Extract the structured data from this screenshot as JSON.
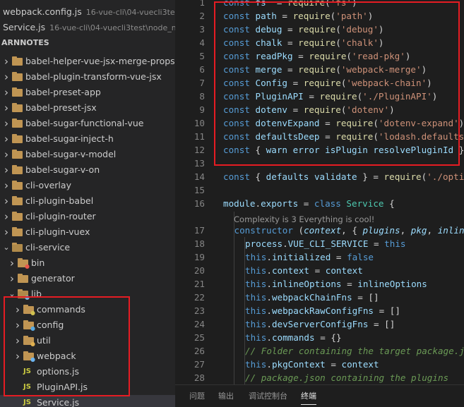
{
  "open_editors": [
    {
      "name": "webpack.config.js",
      "desc": "16-vue-cli\\04-vuecli3test..."
    },
    {
      "name": "Service.js",
      "desc": "16-vue-cli\\04-vuecli3test\\node_m..."
    }
  ],
  "section_title": "ARNNOTES",
  "tree": [
    {
      "label": "babel-helper-vue-jsx-merge-props",
      "depth": 0,
      "kind": "folder",
      "open": false
    },
    {
      "label": "babel-plugin-transform-vue-jsx",
      "depth": 0,
      "kind": "folder",
      "open": false
    },
    {
      "label": "babel-preset-app",
      "depth": 0,
      "kind": "folder",
      "open": false
    },
    {
      "label": "babel-preset-jsx",
      "depth": 0,
      "kind": "folder",
      "open": false
    },
    {
      "label": "babel-sugar-functional-vue",
      "depth": 0,
      "kind": "folder",
      "open": false
    },
    {
      "label": "babel-sugar-inject-h",
      "depth": 0,
      "kind": "folder",
      "open": false
    },
    {
      "label": "babel-sugar-v-model",
      "depth": 0,
      "kind": "folder",
      "open": false
    },
    {
      "label": "babel-sugar-v-on",
      "depth": 0,
      "kind": "folder",
      "open": false
    },
    {
      "label": "cli-overlay",
      "depth": 0,
      "kind": "folder",
      "open": false
    },
    {
      "label": "cli-plugin-babel",
      "depth": 0,
      "kind": "folder",
      "open": false
    },
    {
      "label": "cli-plugin-router",
      "depth": 0,
      "kind": "folder",
      "open": false
    },
    {
      "label": "cli-plugin-vuex",
      "depth": 0,
      "kind": "folder",
      "open": false
    },
    {
      "label": "cli-service",
      "depth": 0,
      "kind": "folder",
      "open": true
    },
    {
      "label": "bin",
      "depth": 1,
      "kind": "folder",
      "open": false,
      "badge": "bin"
    },
    {
      "label": "generator",
      "depth": 1,
      "kind": "folder",
      "open": false
    },
    {
      "label": "lib",
      "depth": 1,
      "kind": "folder",
      "open": true,
      "badge": "lib"
    },
    {
      "label": "commands",
      "depth": 2,
      "kind": "folder",
      "open": false,
      "badge": "cmd"
    },
    {
      "label": "config",
      "depth": 2,
      "kind": "folder",
      "open": false,
      "badge": "cfg"
    },
    {
      "label": "util",
      "depth": 2,
      "kind": "folder",
      "open": false,
      "badge": "util"
    },
    {
      "label": "webpack",
      "depth": 2,
      "kind": "folder",
      "open": false,
      "badge": "wp"
    },
    {
      "label": "options.js",
      "depth": 2,
      "kind": "js"
    },
    {
      "label": "PluginAPI.js",
      "depth": 2,
      "kind": "js"
    },
    {
      "label": "Service.js",
      "depth": 2,
      "kind": "js",
      "selected": true
    }
  ],
  "code_lines": [
    {
      "n": "1",
      "indent": 0,
      "tokens": [
        [
          "kw",
          "const "
        ],
        [
          "var",
          "fs"
        ],
        [
          "",
          "  = "
        ],
        [
          "fn",
          "require"
        ],
        [
          "",
          "("
        ],
        [
          "str",
          "'fs'"
        ],
        [
          "",
          ")"
        ]
      ]
    },
    {
      "n": "2",
      "indent": 0,
      "tokens": [
        [
          "kw",
          "const "
        ],
        [
          "var",
          "path"
        ],
        [
          "",
          " = "
        ],
        [
          "fn",
          "require"
        ],
        [
          "",
          "("
        ],
        [
          "str",
          "'path'"
        ],
        [
          "",
          ")"
        ]
      ]
    },
    {
      "n": "3",
      "indent": 0,
      "tokens": [
        [
          "kw",
          "const "
        ],
        [
          "var",
          "debug"
        ],
        [
          "",
          " = "
        ],
        [
          "fn",
          "require"
        ],
        [
          "",
          "("
        ],
        [
          "str",
          "'debug'"
        ],
        [
          "",
          ")"
        ]
      ]
    },
    {
      "n": "4",
      "indent": 0,
      "tokens": [
        [
          "kw",
          "const "
        ],
        [
          "var",
          "chalk"
        ],
        [
          "",
          " = "
        ],
        [
          "fn",
          "require"
        ],
        [
          "",
          "("
        ],
        [
          "str",
          "'chalk'"
        ],
        [
          "",
          ")"
        ]
      ]
    },
    {
      "n": "5",
      "indent": 0,
      "tokens": [
        [
          "kw",
          "const "
        ],
        [
          "var",
          "readPkg"
        ],
        [
          "",
          " = "
        ],
        [
          "fn",
          "require"
        ],
        [
          "",
          "("
        ],
        [
          "str",
          "'read-pkg'"
        ],
        [
          "",
          ")"
        ]
      ]
    },
    {
      "n": "6",
      "indent": 0,
      "tokens": [
        [
          "kw",
          "const "
        ],
        [
          "var",
          "merge"
        ],
        [
          "",
          " = "
        ],
        [
          "fn",
          "require"
        ],
        [
          "",
          "("
        ],
        [
          "str",
          "'webpack-merge'"
        ],
        [
          "",
          ")"
        ]
      ]
    },
    {
      "n": "7",
      "indent": 0,
      "tokens": [
        [
          "kw",
          "const "
        ],
        [
          "var",
          "Config"
        ],
        [
          "",
          " = "
        ],
        [
          "fn",
          "require"
        ],
        [
          "",
          "("
        ],
        [
          "str",
          "'webpack-chain'"
        ],
        [
          "",
          ")"
        ]
      ]
    },
    {
      "n": "8",
      "indent": 0,
      "tokens": [
        [
          "kw",
          "const "
        ],
        [
          "var",
          "PluginAPI"
        ],
        [
          "",
          " = "
        ],
        [
          "fn",
          "require"
        ],
        [
          "",
          "("
        ],
        [
          "str",
          "'./PluginAPI'"
        ],
        [
          "",
          ")"
        ]
      ]
    },
    {
      "n": "9",
      "indent": 0,
      "tokens": [
        [
          "kw",
          "const "
        ],
        [
          "var",
          "dotenv"
        ],
        [
          "",
          " = "
        ],
        [
          "fn",
          "require"
        ],
        [
          "",
          "("
        ],
        [
          "str",
          "'dotenv'"
        ],
        [
          "",
          ")"
        ]
      ]
    },
    {
      "n": "10",
      "indent": 0,
      "tokens": [
        [
          "kw",
          "const "
        ],
        [
          "var",
          "dotenvExpand"
        ],
        [
          "",
          " = "
        ],
        [
          "fn",
          "require"
        ],
        [
          "",
          "("
        ],
        [
          "str",
          "'dotenv-expand'"
        ],
        [
          "",
          ")"
        ]
      ]
    },
    {
      "n": "11",
      "indent": 0,
      "tokens": [
        [
          "kw",
          "const "
        ],
        [
          "var",
          "defaultsDeep"
        ],
        [
          "",
          " = "
        ],
        [
          "fn",
          "require"
        ],
        [
          "",
          "("
        ],
        [
          "str",
          "'lodash.defaultsDeep'"
        ],
        [
          "",
          ")"
        ]
      ]
    },
    {
      "n": "12",
      "indent": 0,
      "tokens": [
        [
          "kw",
          "const "
        ],
        [
          "",
          "{ "
        ],
        [
          "var",
          "warn"
        ],
        [
          ", ",
          " "
        ],
        [
          "var",
          "error"
        ],
        [
          ", ",
          " "
        ],
        [
          "var",
          "isPlugin"
        ],
        [
          ", ",
          " "
        ],
        [
          "var",
          "resolvePluginId"
        ],
        [
          "",
          " }"
        ]
      ]
    },
    {
      "n": "13",
      "indent": 0,
      "tokens": []
    },
    {
      "n": "14",
      "indent": 0,
      "tokens": [
        [
          "kw",
          "const "
        ],
        [
          "",
          "{ "
        ],
        [
          "var",
          "defaults"
        ],
        [
          ", ",
          " "
        ],
        [
          "var",
          "validate"
        ],
        [
          "",
          " } = "
        ],
        [
          "fn",
          "require"
        ],
        [
          "",
          "("
        ],
        [
          "str",
          "'./options'"
        ],
        [
          "",
          ")"
        ]
      ]
    },
    {
      "n": "15",
      "indent": 0,
      "tokens": []
    },
    {
      "n": "16",
      "indent": 0,
      "tokens": [
        [
          "var",
          "module"
        ],
        [
          "",
          "."
        ],
        [
          "var",
          "exports"
        ],
        [
          "",
          " = "
        ],
        [
          "kw",
          "class "
        ],
        [
          "cls",
          "Service"
        ],
        [
          "",
          " {"
        ]
      ]
    },
    {
      "n": "17",
      "indent": 1,
      "tokens": [
        [
          "kw",
          "constructor "
        ],
        [
          "",
          "("
        ],
        [
          "prm",
          "context"
        ],
        [
          "",
          ", { "
        ],
        [
          "prm",
          "plugins"
        ],
        [
          "",
          ", "
        ],
        [
          "prm",
          "pkg"
        ],
        [
          "",
          ", "
        ],
        [
          "prm",
          "inlineOptions"
        ],
        [
          "",
          ", "
        ]
      ]
    },
    {
      "n": "18",
      "indent": 2,
      "tokens": [
        [
          "var",
          "process"
        ],
        [
          "",
          "."
        ],
        [
          "var",
          "VUE_CLI_SERVICE"
        ],
        [
          "",
          " = "
        ],
        [
          "this",
          "this"
        ]
      ]
    },
    {
      "n": "19",
      "indent": 2,
      "tokens": [
        [
          "this",
          "this"
        ],
        [
          "",
          "."
        ],
        [
          "prop",
          "initialized"
        ],
        [
          "",
          " = "
        ],
        [
          "kw",
          "false"
        ]
      ]
    },
    {
      "n": "20",
      "indent": 2,
      "tokens": [
        [
          "this",
          "this"
        ],
        [
          "",
          "."
        ],
        [
          "prop",
          "context"
        ],
        [
          "",
          " = "
        ],
        [
          "var",
          "context"
        ]
      ]
    },
    {
      "n": "21",
      "indent": 2,
      "tokens": [
        [
          "this",
          "this"
        ],
        [
          "",
          "."
        ],
        [
          "prop",
          "inlineOptions"
        ],
        [
          "",
          " = "
        ],
        [
          "var",
          "inlineOptions"
        ]
      ]
    },
    {
      "n": "22",
      "indent": 2,
      "tokens": [
        [
          "this",
          "this"
        ],
        [
          "",
          "."
        ],
        [
          "prop",
          "webpackChainFns"
        ],
        [
          "",
          " = []"
        ]
      ]
    },
    {
      "n": "23",
      "indent": 2,
      "tokens": [
        [
          "this",
          "this"
        ],
        [
          "",
          "."
        ],
        [
          "prop",
          "webpackRawConfigFns"
        ],
        [
          "",
          " = []"
        ]
      ]
    },
    {
      "n": "24",
      "indent": 2,
      "tokens": [
        [
          "this",
          "this"
        ],
        [
          "",
          "."
        ],
        [
          "prop",
          "devServerConfigFns"
        ],
        [
          "",
          " = []"
        ]
      ]
    },
    {
      "n": "25",
      "indent": 2,
      "tokens": [
        [
          "this",
          "this"
        ],
        [
          "",
          "."
        ],
        [
          "prop",
          "commands"
        ],
        [
          "",
          " = {}"
        ]
      ]
    },
    {
      "n": "26",
      "indent": 2,
      "tokens": [
        [
          "cmt",
          "// Folder containing the target package.json"
        ]
      ]
    },
    {
      "n": "27",
      "indent": 2,
      "tokens": [
        [
          "this",
          "this"
        ],
        [
          "",
          "."
        ],
        [
          "prop",
          "pkgContext"
        ],
        [
          "",
          " = "
        ],
        [
          "var",
          "context"
        ]
      ]
    },
    {
      "n": "28",
      "indent": 2,
      "tokens": [
        [
          "cmt",
          "// package.json containing the plugins"
        ]
      ]
    }
  ],
  "codelens": "Complexity is 3 Everything is cool!",
  "panel_tabs": [
    {
      "label": "问题",
      "active": false
    },
    {
      "label": "输出",
      "active": false
    },
    {
      "label": "调试控制台",
      "active": false
    },
    {
      "label": "终端",
      "active": true
    }
  ],
  "colors": {
    "highlight_box": "#e51c23",
    "folder": "#c09553",
    "js": "#cbcb41"
  }
}
